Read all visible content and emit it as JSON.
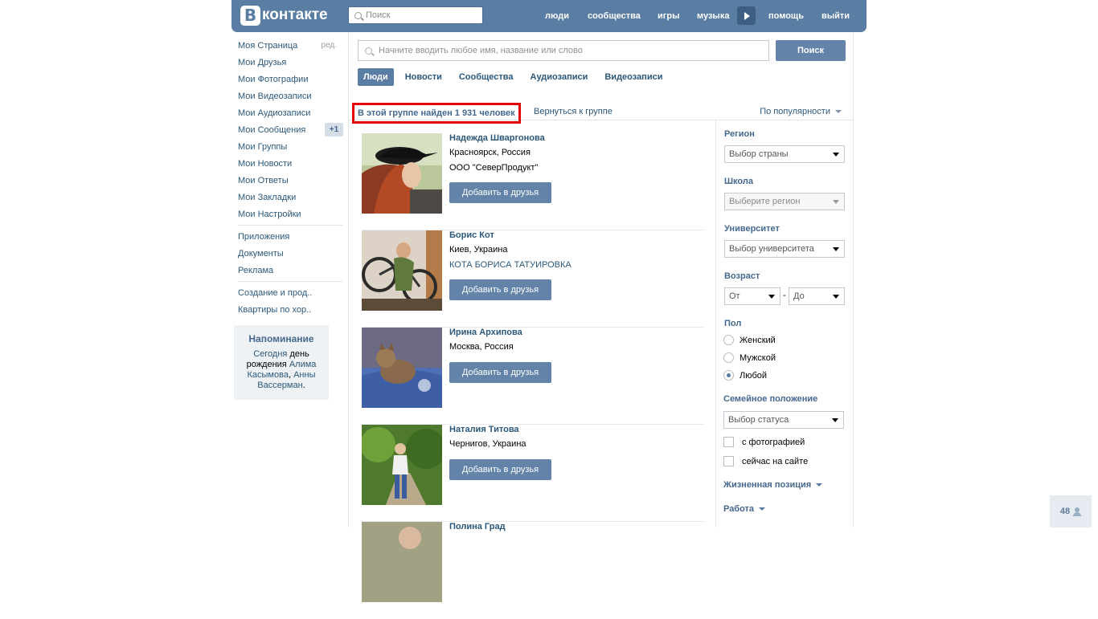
{
  "header": {
    "logo_letter": "В",
    "logo_text": "контакте",
    "search_placeholder": "Поиск",
    "nav": {
      "people": "люди",
      "communities": "сообщества",
      "games": "игры",
      "music": "музыка",
      "help": "помощь",
      "logout": "выйти"
    }
  },
  "leftmenu": {
    "edit_label": "ред.",
    "messages_badge": "+1",
    "items": [
      "Моя Страница",
      "Мои Друзья",
      "Мои Фотографии",
      "Мои Видеозаписи",
      "Мои Аудиозаписи",
      "Мои Сообщения",
      "Мои Группы",
      "Мои Новости",
      "Мои Ответы",
      "Мои Закладки",
      "Мои Настройки"
    ],
    "items2": [
      "Приложения",
      "Документы",
      "Реклама"
    ],
    "items3": [
      "Создание и прод..",
      "Квартиры по хор.."
    ]
  },
  "reminder": {
    "title": "Напоминание",
    "link_today": "Сегодня",
    "text_birthday": "день рождения",
    "name1": "Алима Касымова",
    "sep": ",",
    "name2": "Анны Вассерман",
    "end": "."
  },
  "search": {
    "placeholder": "Начните вводить любое имя, название или слово",
    "button": "Поиск",
    "tabs": [
      "Люди",
      "Новости",
      "Сообщества",
      "Аудиозаписи",
      "Видеозаписи"
    ]
  },
  "results": {
    "found_text": "В этой группе найден 1 931 человек",
    "back_link": "Вернуться к группе",
    "sort_label": "По популярности"
  },
  "people": [
    {
      "name": "Надежда Швargонова",
      "line1": "Красноярск, Россия",
      "line2": "ООО \"СеверПродукт\"",
      "line2_link": false,
      "button": "Добавить в друзья"
    },
    {
      "name": "Борис Кот",
      "line1": "Киев, Украина",
      "line2": "КОТА БОРИСА ТАТУИРОВКА",
      "line2_link": true,
      "button": "Добавить в друзья"
    },
    {
      "name": "Ирина Архипова",
      "line1": "Москва, Россия",
      "line2": "",
      "line2_link": false,
      "button": "Добавить в друзья"
    },
    {
      "name": "Наталия Титова",
      "line1": "Чернигов, Украина",
      "line2": "",
      "line2_link": false,
      "button": "Добавить в друзья"
    },
    {
      "name": "Полина Град",
      "line1": "",
      "line2": "",
      "line2_link": false,
      "button": ""
    }
  ],
  "filters": {
    "region_label": "Регион",
    "region_value": "Выбор страны",
    "school_label": "Школа",
    "school_value": "Выберите регион",
    "university_label": "Университет",
    "university_value": "Выбор университета",
    "age_label": "Возраст",
    "age_from": "От",
    "age_dash": "-",
    "age_to": "До",
    "sex_label": "Пол",
    "sex_options": [
      "Женский",
      "Мужской",
      "Любой"
    ],
    "sex_selected": 2,
    "marital_label": "Семейное положение",
    "marital_value": "Выбор статуса",
    "with_photo": "с фотографией",
    "online_now": "сейчас на сайте",
    "life_position": "Жизненная позиция",
    "work": "Работа"
  },
  "counter": {
    "value": "48"
  }
}
